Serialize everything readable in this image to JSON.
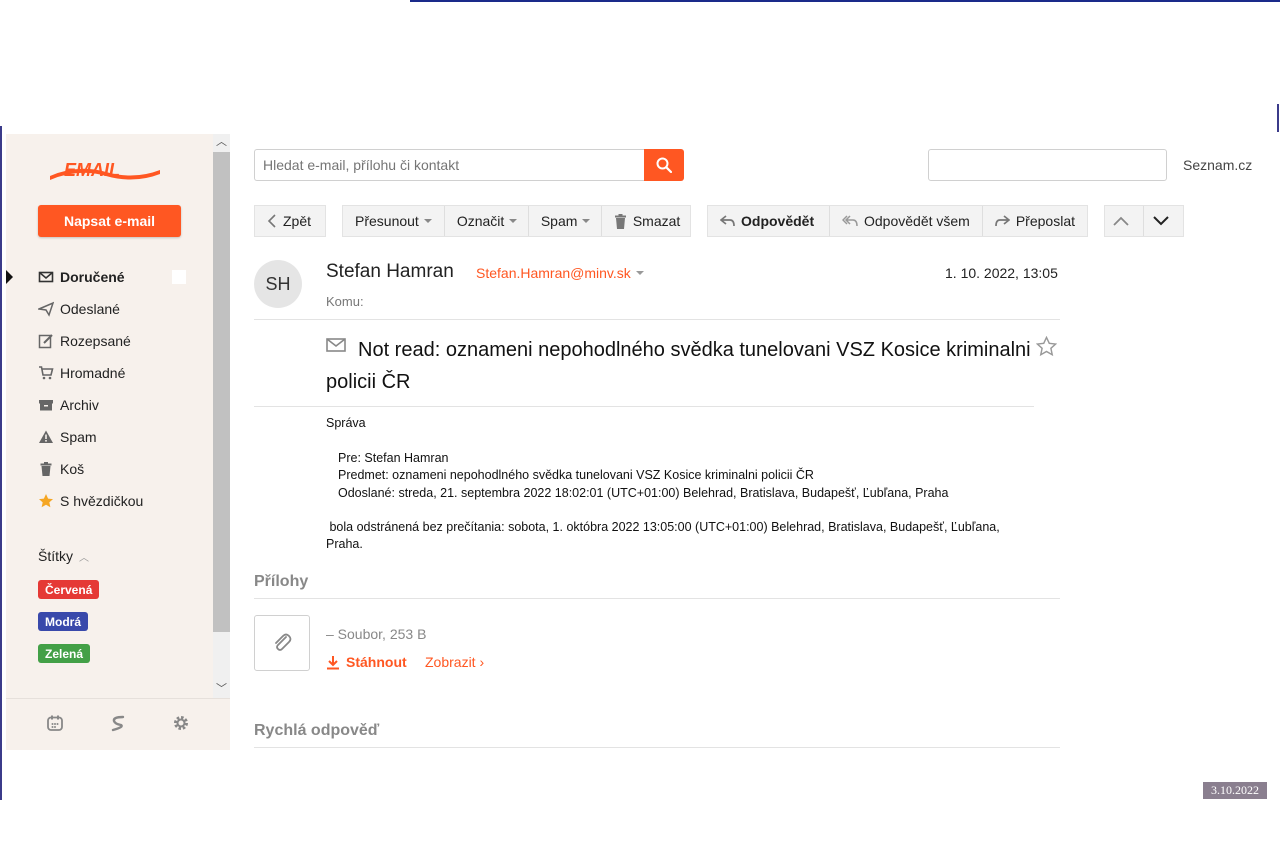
{
  "sidebar": {
    "compose_label": "Napsat e-mail",
    "folders": [
      {
        "label": "Doručené",
        "icon": "envelope-icon"
      },
      {
        "label": "Odeslané",
        "icon": "send-icon"
      },
      {
        "label": "Rozepsané",
        "icon": "edit-icon"
      },
      {
        "label": "Hromadné",
        "icon": "cart-icon"
      },
      {
        "label": "Archiv",
        "icon": "archive-icon"
      },
      {
        "label": "Spam",
        "icon": "warning-icon"
      },
      {
        "label": "Koš",
        "icon": "trash-icon"
      },
      {
        "label": "S hvězdičkou",
        "icon": "star-icon"
      }
    ],
    "labels_heading": "Štítky",
    "tags": [
      {
        "label": "Červená",
        "color": "#e53935"
      },
      {
        "label": "Modrá",
        "color": "#3949ab"
      },
      {
        "label": "Zelená",
        "color": "#43a047"
      }
    ],
    "bottom_icons": [
      "calendar-icon",
      "seznam-logo-icon",
      "gear-icon"
    ]
  },
  "search": {
    "placeholder": "Hledat e-mail, přílohu či kontakt",
    "right_link": "Seznam.cz"
  },
  "toolbar": {
    "back": "Zpět",
    "move": "Přesunout",
    "mark": "Označit",
    "spam": "Spam",
    "delete": "Smazat",
    "reply": "Odpovědět",
    "reply_all": "Odpovědět všem",
    "forward": "Přeposlat"
  },
  "message": {
    "avatar_initials": "SH",
    "sender_name": "Stefan Hamran",
    "sender_email": "Stefan.Hamran@minv.sk",
    "date": "1. 10. 2022, 13:05",
    "to_label": "Komu:",
    "subject": "Not read: oznameni nepohodlného svědka tunelovani VSZ Kosice kriminalni policii ČR",
    "body": {
      "heading": "Správa",
      "to_line": "Pre: Stefan Hamran",
      "subject_line": "Predmet: oznameni nepohodlného svědka tunelovani VSZ Kosice kriminalni policii ČR",
      "sent_line": "Odoslané: streda, 21. septembra 2022 18:02:01 (UTC+01:00) Belehrad, Bratislava, Budapešť, Ľubľana, Praha",
      "removed_line": " bola odstránená bez prečítania: sobota, 1. októbra 2022 13:05:00 (UTC+01:00) Belehrad, Bratislava, Budapešť, Ľubľana, Praha."
    }
  },
  "attachments": {
    "heading": "Přílohy",
    "file_info": "– Soubor, 253 B",
    "download_label": "Stáhnout",
    "view_label": "Zobrazit ›"
  },
  "quick_reply": {
    "heading": "Rychlá odpověď"
  },
  "overlay_date": "3.10.2022",
  "colors": {
    "accent": "#ff5722",
    "sidebar_bg": "#f7f1ec"
  }
}
